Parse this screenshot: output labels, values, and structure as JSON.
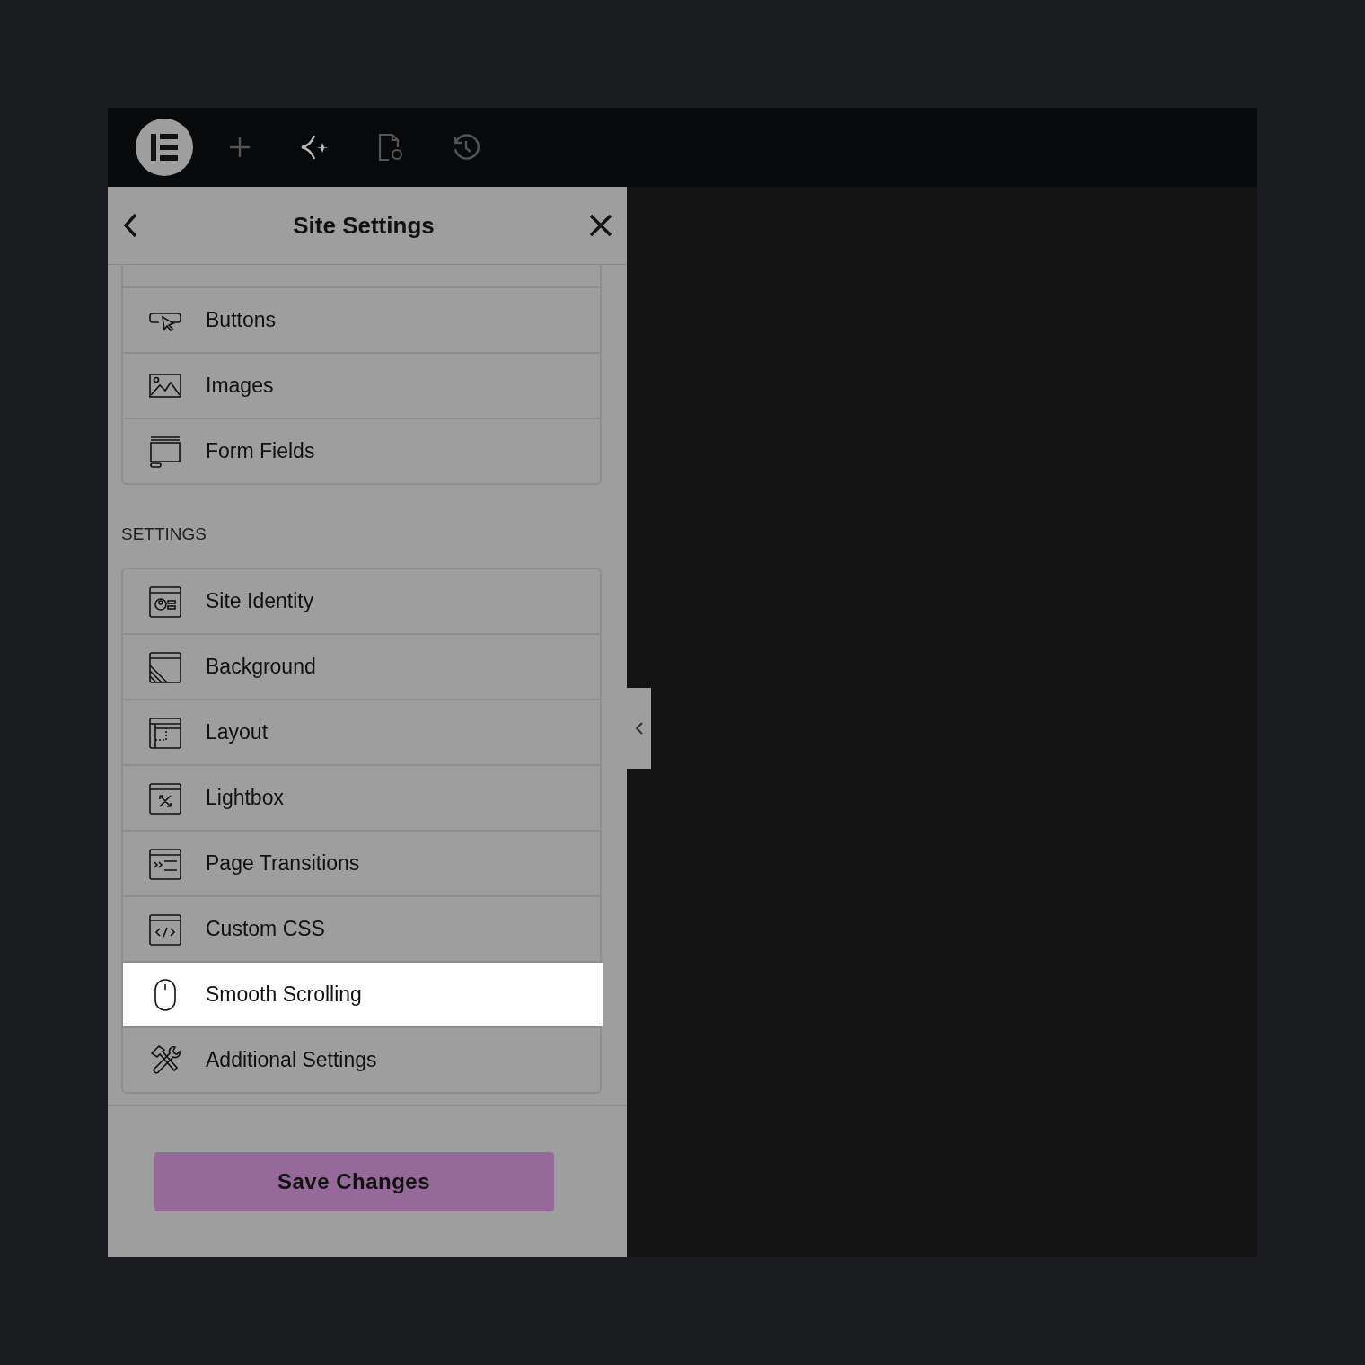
{
  "toolbar": {
    "buttons": [
      {
        "kind": "logo"
      },
      {
        "kind": "add"
      },
      {
        "kind": "ai"
      },
      {
        "kind": "page-settings"
      },
      {
        "kind": "history"
      }
    ]
  },
  "panel": {
    "title": "Site Settings",
    "groups": [
      {
        "items": [
          {
            "kind": "buttons",
            "label": "Buttons",
            "selected": false
          },
          {
            "kind": "images",
            "label": "Images",
            "selected": false
          },
          {
            "kind": "form-fields",
            "label": "Form Fields",
            "selected": false
          }
        ]
      },
      {
        "heading": "SETTINGS",
        "items": [
          {
            "kind": "site-identity",
            "label": "Site Identity",
            "selected": false
          },
          {
            "kind": "background",
            "label": "Background",
            "selected": false
          },
          {
            "kind": "layout",
            "label": "Layout",
            "selected": false
          },
          {
            "kind": "lightbox",
            "label": "Lightbox",
            "selected": false
          },
          {
            "kind": "page-transitions",
            "label": "Page Transitions",
            "selected": false
          },
          {
            "kind": "custom-css",
            "label": "Custom CSS",
            "selected": false
          },
          {
            "kind": "smooth-scrolling",
            "label": "Smooth Scrolling",
            "selected": true
          },
          {
            "kind": "additional-settings",
            "label": "Additional Settings",
            "selected": false
          }
        ]
      }
    ],
    "save_button": "Save Changes"
  }
}
